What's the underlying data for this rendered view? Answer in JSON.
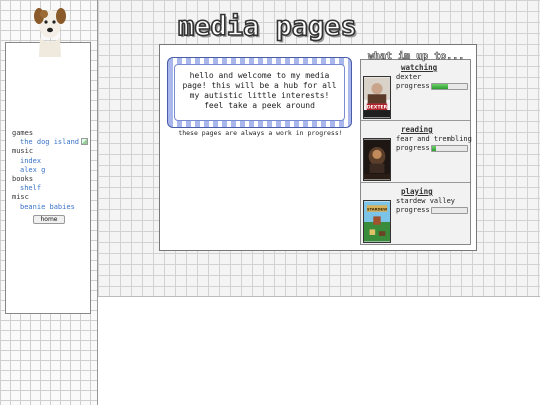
{
  "header": {
    "title": "media pages"
  },
  "sidebar": {
    "nav": [
      {
        "category": "games",
        "links": [
          "the dog island"
        ]
      },
      {
        "category": "music",
        "links": [
          "index",
          "alex g"
        ]
      },
      {
        "category": "books",
        "links": [
          "shelf"
        ]
      },
      {
        "category": "misc",
        "links": [
          "beanie babies"
        ]
      }
    ],
    "home_label": "home"
  },
  "welcome": {
    "message": "hello and welcome to my media page! this will be a hub for all my autistic little interests! feel take a peek around",
    "caption": "these pages are always a work in progress!"
  },
  "status": {
    "title": "what im up to...",
    "items": [
      {
        "heading": "watching",
        "name": "dexter",
        "progress_label": "progress:",
        "progress": 0.45,
        "cover_text": "DEXTER",
        "color": "#b2202a"
      },
      {
        "heading": "reading",
        "name": "fear and trembling",
        "progress_label": "progress:",
        "progress": 0.1,
        "cover_text": "",
        "color": "#3a2a22"
      },
      {
        "heading": "playing",
        "name": "stardew valley",
        "progress_label": "progress:",
        "progress": 0.0,
        "cover_text": "STARDEW",
        "color": "#3b8c3a"
      }
    ]
  }
}
